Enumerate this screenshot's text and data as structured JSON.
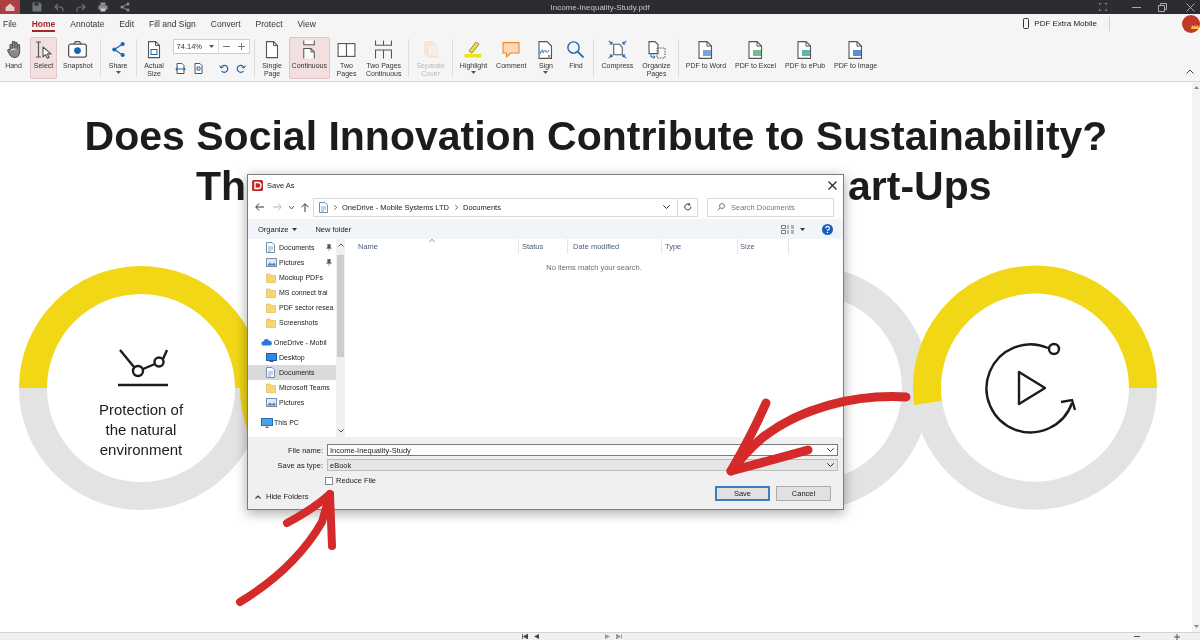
{
  "app_bar": {
    "title": "Income-Inequality-Study.pdf"
  },
  "menu_tabs": [
    {
      "label": "File",
      "selected": false
    },
    {
      "label": "Home",
      "selected": true
    },
    {
      "label": "Annotate",
      "selected": false
    },
    {
      "label": "Edit",
      "selected": false
    },
    {
      "label": "Fill and Sign",
      "selected": false
    },
    {
      "label": "Convert",
      "selected": false
    },
    {
      "label": "Protect",
      "selected": false
    },
    {
      "label": "View",
      "selected": false
    }
  ],
  "mobile_link": "PDF Extra Mobile",
  "ribbon_groups": [
    {
      "kind": "tools",
      "tools": [
        {
          "label": "Hand",
          "selected": false,
          "disabled": false,
          "menu": false
        },
        {
          "label": "Select",
          "selected": true,
          "disabled": false,
          "menu": false
        },
        {
          "label": "Snapshot",
          "selected": false,
          "disabled": false,
          "menu": false
        }
      ]
    },
    {
      "kind": "tools",
      "tools": [
        {
          "label": "Share",
          "selected": false,
          "disabled": false,
          "menu": true
        }
      ]
    },
    {
      "kind": "zoom",
      "tools": [
        {
          "label": "Actual\nSize",
          "selected": false,
          "disabled": false,
          "menu": false
        }
      ],
      "zoom_value": "74.14%"
    },
    {
      "kind": "tools",
      "tools": [
        {
          "label": "Single\nPage",
          "selected": false,
          "disabled": false,
          "menu": false
        },
        {
          "label": "Continuous",
          "selected": true,
          "disabled": false,
          "menu": false
        },
        {
          "label": "Two\nPages",
          "selected": false,
          "disabled": false,
          "menu": false
        },
        {
          "label": "Two Pages\nContinuous",
          "selected": false,
          "disabled": false,
          "menu": false
        }
      ]
    },
    {
      "kind": "tools",
      "tools": [
        {
          "label": "Separate\nCover",
          "selected": false,
          "disabled": true,
          "menu": false
        }
      ]
    },
    {
      "kind": "tools",
      "tools": [
        {
          "label": "Highlight",
          "selected": false,
          "disabled": false,
          "menu": true
        },
        {
          "label": "Comment",
          "selected": false,
          "disabled": false,
          "menu": false
        },
        {
          "label": "Sign",
          "selected": false,
          "disabled": false,
          "menu": true
        },
        {
          "label": "Find",
          "selected": false,
          "disabled": false,
          "menu": false
        }
      ]
    },
    {
      "kind": "tools",
      "tools": [
        {
          "label": "Compress",
          "selected": false,
          "disabled": false,
          "menu": false
        },
        {
          "label": "Organize\nPages",
          "selected": false,
          "disabled": false,
          "menu": false
        }
      ]
    },
    {
      "kind": "tools",
      "tools": [
        {
          "label": "PDF to Word",
          "selected": false,
          "disabled": false,
          "menu": false
        },
        {
          "label": "PDF to Excel",
          "selected": false,
          "disabled": false,
          "menu": false
        },
        {
          "label": "PDF to ePub",
          "selected": false,
          "disabled": false,
          "menu": false
        },
        {
          "label": "PDF to Image",
          "selected": false,
          "disabled": false,
          "menu": false
        }
      ]
    }
  ],
  "document": {
    "heading": "Does Social Innovation Contribute to Sustainability?",
    "heading_fragments": [
      "Th",
      "art-Ups"
    ],
    "circle_caption": "Protection of the natural environment"
  },
  "save_dialog": {
    "title": "Save As",
    "path": [
      "OneDrive - Mobile Systems LTD",
      "Documents"
    ],
    "search": {
      "placeholder": "Search Documents"
    },
    "toolbar": [
      {
        "label": "Organize",
        "menu": true
      },
      {
        "label": "New folder",
        "menu": false
      }
    ],
    "quick_access": [
      {
        "label": "Documents",
        "kind": "documents",
        "pinned": true,
        "selected": false
      },
      {
        "label": "Pictures",
        "kind": "pictures",
        "pinned": true,
        "selected": false
      },
      {
        "label": "Mockup PDFs",
        "kind": "folder",
        "pinned": false,
        "selected": false
      },
      {
        "label": "MS connect trai",
        "kind": "folder",
        "pinned": false,
        "selected": false
      },
      {
        "label": "PDF sector resea",
        "kind": "folder",
        "pinned": false,
        "selected": false
      },
      {
        "label": "Screenshots",
        "kind": "folder",
        "pinned": false,
        "selected": false
      }
    ],
    "locations": [
      {
        "label": "OneDrive - Mobil",
        "kind": "cloud",
        "selected": false,
        "children": [
          {
            "label": "Desktop",
            "kind": "desktop",
            "selected": false
          },
          {
            "label": "Documents",
            "kind": "documents",
            "selected": true
          },
          {
            "label": "Microsoft Teams",
            "kind": "folder",
            "selected": false
          },
          {
            "label": "Pictures",
            "kind": "pictures",
            "selected": false
          }
        ]
      },
      {
        "label": "This PC",
        "kind": "pc",
        "selected": false
      }
    ],
    "columns": [
      {
        "label": "Name",
        "sorted": true
      },
      {
        "label": "Status",
        "sorted": false
      },
      {
        "label": "Date modified",
        "sorted": false
      },
      {
        "label": "Type",
        "sorted": false
      },
      {
        "label": "Size",
        "sorted": false
      }
    ],
    "empty_message": "No items match your search.",
    "file_name": {
      "label": "File name:",
      "value": "Income-Inequality-Study"
    },
    "save_type": {
      "label": "Save as type:",
      "value": "eBook"
    },
    "reduce_file": {
      "label": "Reduce File",
      "checked": false
    },
    "hide_folders": "Hide Folders",
    "buttons": [
      {
        "label": "Save",
        "default": true
      },
      {
        "label": "Cancel",
        "default": false
      }
    ]
  }
}
